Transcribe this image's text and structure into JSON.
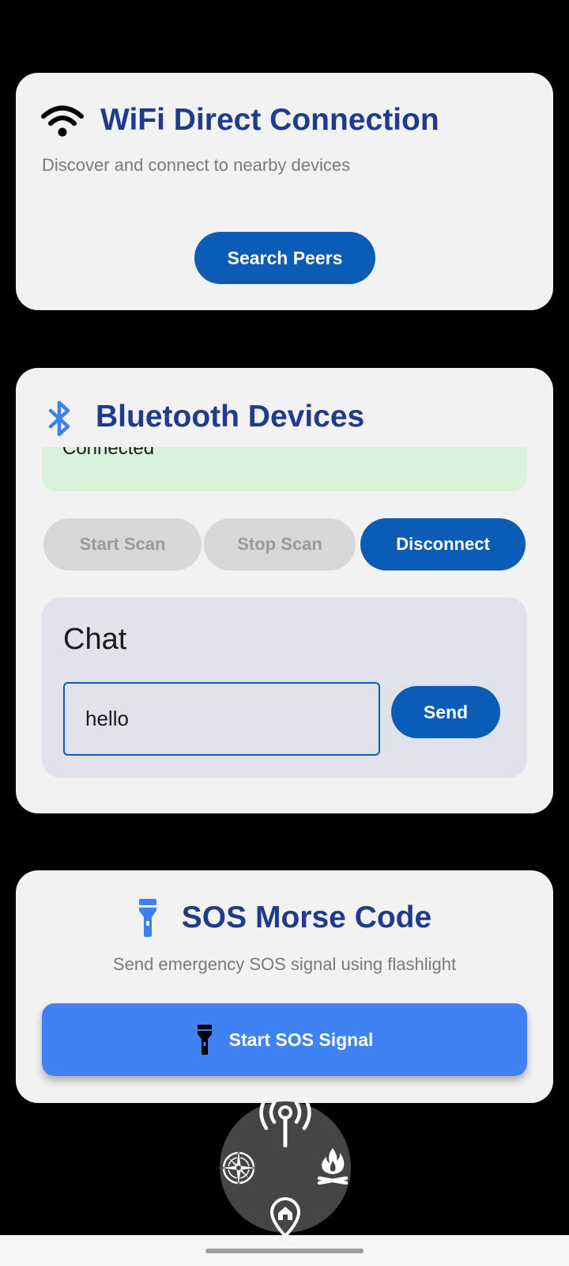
{
  "wifi": {
    "title": "WiFi Direct Connection",
    "subtitle": "Discover and connect to nearby devices",
    "search_button": "Search Peers",
    "icon": "wifi-icon"
  },
  "bluetooth": {
    "title": "Bluetooth Devices",
    "icon": "bluetooth-icon",
    "status": "Connected",
    "buttons": {
      "start_scan": "Start Scan",
      "stop_scan": "Stop Scan",
      "disconnect": "Disconnect"
    },
    "chat": {
      "title": "Chat",
      "input_value": "hello",
      "send_label": "Send"
    }
  },
  "sos": {
    "title": "SOS Morse Code",
    "subtitle": "Send emergency SOS signal using flashlight",
    "button_label": "Start SOS Signal",
    "icon": "flashlight-icon"
  },
  "radial_menu": {
    "items": [
      "signal-tower-icon",
      "compass-icon",
      "campfire-icon",
      "home-location-icon"
    ]
  },
  "colors": {
    "primary": "#0a5cb5",
    "title": "#1f3b8a",
    "sos_button": "#3f83f2",
    "status_bg": "#d9f2db",
    "card_bg": "#f2f2f3",
    "background": "#000000"
  }
}
